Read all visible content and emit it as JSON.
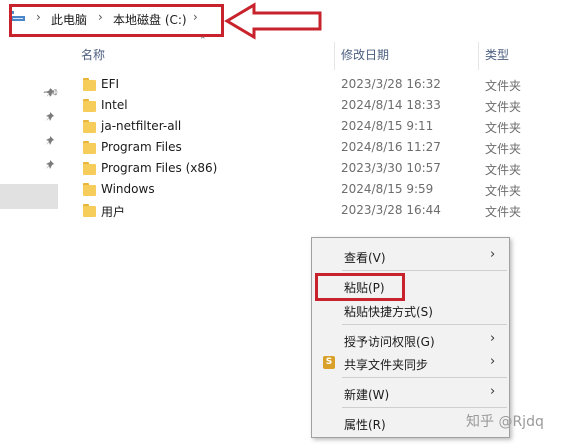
{
  "address_bar": {
    "crumbs": [
      "此电脑",
      "本地磁盘 (C:)"
    ],
    "highlight_color": "#c8232c"
  },
  "columns": {
    "name": "名称",
    "modified": "修改日期",
    "type": "类型"
  },
  "files": [
    {
      "name": "EFI",
      "modified": "2023/3/28 16:32",
      "type": "文件夹"
    },
    {
      "name": "Intel",
      "modified": "2024/8/14 18:33",
      "type": "文件夹"
    },
    {
      "name": "ja-netfilter-all",
      "modified": "2024/8/15 9:11",
      "type": "文件夹"
    },
    {
      "name": "Program Files",
      "modified": "2024/8/16 11:27",
      "type": "文件夹"
    },
    {
      "name": "Program Files (x86)",
      "modified": "2023/3/30 10:57",
      "type": "文件夹"
    },
    {
      "name": "Windows",
      "modified": "2024/8/15 9:59",
      "type": "文件夹"
    },
    {
      "name": "用户",
      "modified": "2023/3/28 16:44",
      "type": "文件夹"
    }
  ],
  "context_menu": {
    "items": [
      {
        "label": "查看(V)",
        "submenu": true
      },
      {
        "label": "粘贴(P)",
        "submenu": false
      },
      {
        "label": "粘贴快捷方式(S)",
        "submenu": false
      },
      {
        "label": "授予访问权限(G)",
        "submenu": true
      },
      {
        "label": "共享文件夹同步",
        "submenu": true
      },
      {
        "label": "新建(W)",
        "submenu": true
      },
      {
        "label": "属性(R)",
        "submenu": false
      }
    ]
  },
  "watermark": "知乎 @Rjdq"
}
